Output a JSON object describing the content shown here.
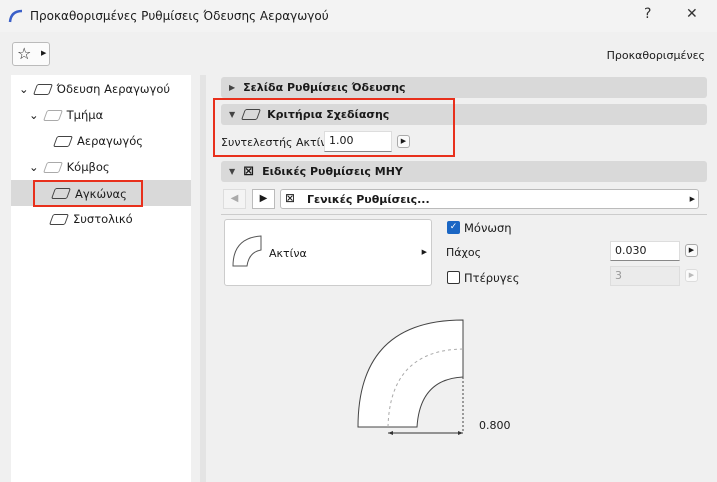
{
  "window": {
    "title": "Προκαθορισμένες Ρυθμίσεις Όδευσης Αεραγωγού",
    "help": "?",
    "close": "✕"
  },
  "toolbar": {
    "preset_label": "Προκαθορισμένες"
  },
  "tree": [
    {
      "label": "Όδευση Αεραγωγού"
    },
    {
      "label": "Τμήμα"
    },
    {
      "label": "Αεραγωγός"
    },
    {
      "label": "Κόμβος"
    },
    {
      "label": "Αγκώνας",
      "selected": true
    },
    {
      "label": "Συστολικό"
    }
  ],
  "sections": {
    "route": {
      "title": "Σελίδα Ρυθμίσεις Όδευσης"
    },
    "design": {
      "title": "Κριτήρια Σχεδίασης",
      "radius_label": "Συντελεστής Ακτίνα",
      "radius_value": "1.00"
    },
    "mep": {
      "title": "Ειδικές Ρυθμίσεις ΜΗΥ",
      "page": "Γενικές Ρυθμίσεις...",
      "type_label": "Ακτίνα",
      "insulation_label": "Μόνωση",
      "insulation_checked": true,
      "thickness_label": "Πάχος",
      "thickness_value": "0.030",
      "vanes_label": "Πτέρυγες",
      "vanes_checked": false,
      "vanes_value": "3",
      "dimension": "0.800"
    }
  }
}
